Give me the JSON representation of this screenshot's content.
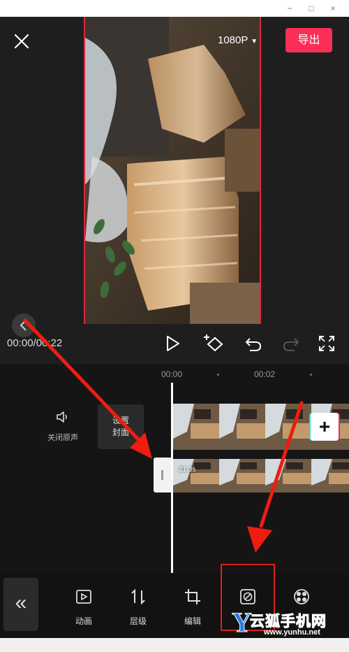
{
  "window": {
    "controls": [
      "−",
      "□",
      "×"
    ]
  },
  "header": {
    "resolution": "1080P",
    "export_label": "导出"
  },
  "player": {
    "timecode": "00:00/00:22"
  },
  "timeline": {
    "ruler": [
      "00:00",
      "00:02"
    ],
    "mute_label": "关闭原声",
    "cover_label_line1": "设置",
    "cover_label_line2": "封面",
    "clip_duration": "21.3s",
    "add_label": "+"
  },
  "toolbar": {
    "collapse_label": "«",
    "items": [
      {
        "label": "动画",
        "icon": "animation-icon"
      },
      {
        "label": "层级",
        "icon": "layer-icon"
      },
      {
        "label": "编辑",
        "icon": "crop-icon"
      },
      {
        "label": "",
        "icon": "no-entry-icon"
      },
      {
        "label": "",
        "icon": "filter-icon"
      }
    ]
  },
  "watermark": {
    "brand": "云狐手机网",
    "url": "www.yunhu.net"
  },
  "colors": {
    "accent": "#fa2e57",
    "annotation": "#e0201c",
    "watermark": "#2a7be0"
  }
}
